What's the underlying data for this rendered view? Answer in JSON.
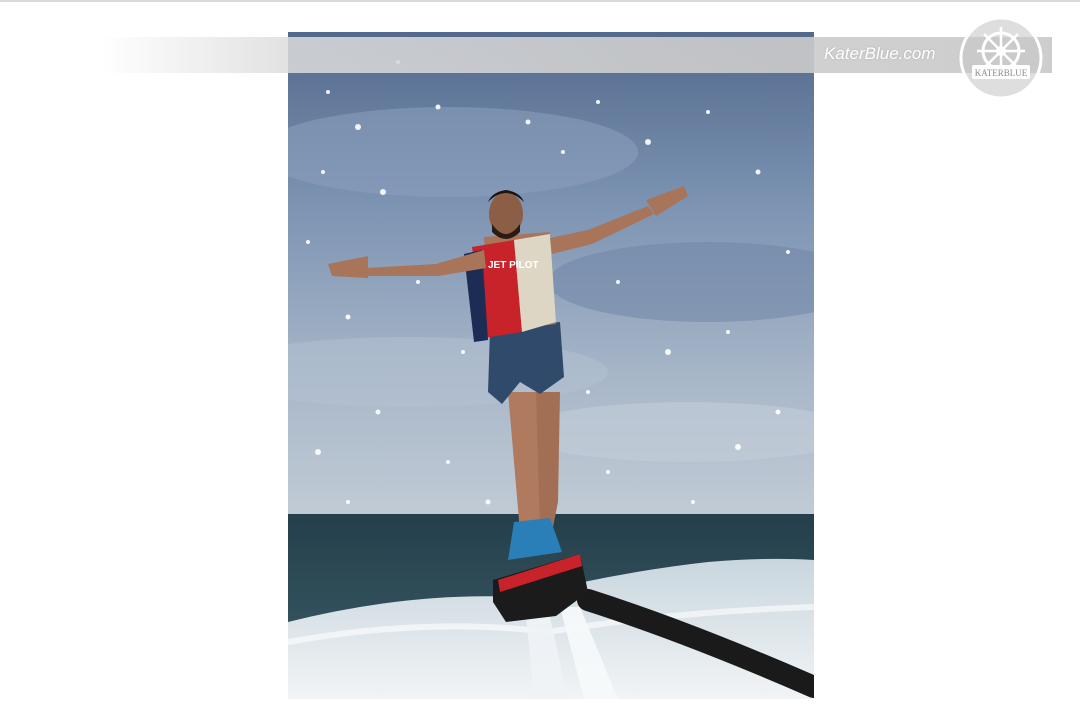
{
  "watermark": {
    "site_text": "KaterBlue.com",
    "logo_text": "KATERBLUE",
    "logo_icon": "ship-wheel-icon"
  },
  "photo": {
    "subject": "flyboard-rider-photo",
    "vest_text": "JET PILOT"
  },
  "colors": {
    "sky": "#7f95b2",
    "sea": "#2f4f5a",
    "foam": "#e6ecf0",
    "vest_red": "#c8222a",
    "vest_navy": "#1d2c55",
    "hose": "#1a1a1a",
    "watermark_text": "#ffffff"
  }
}
